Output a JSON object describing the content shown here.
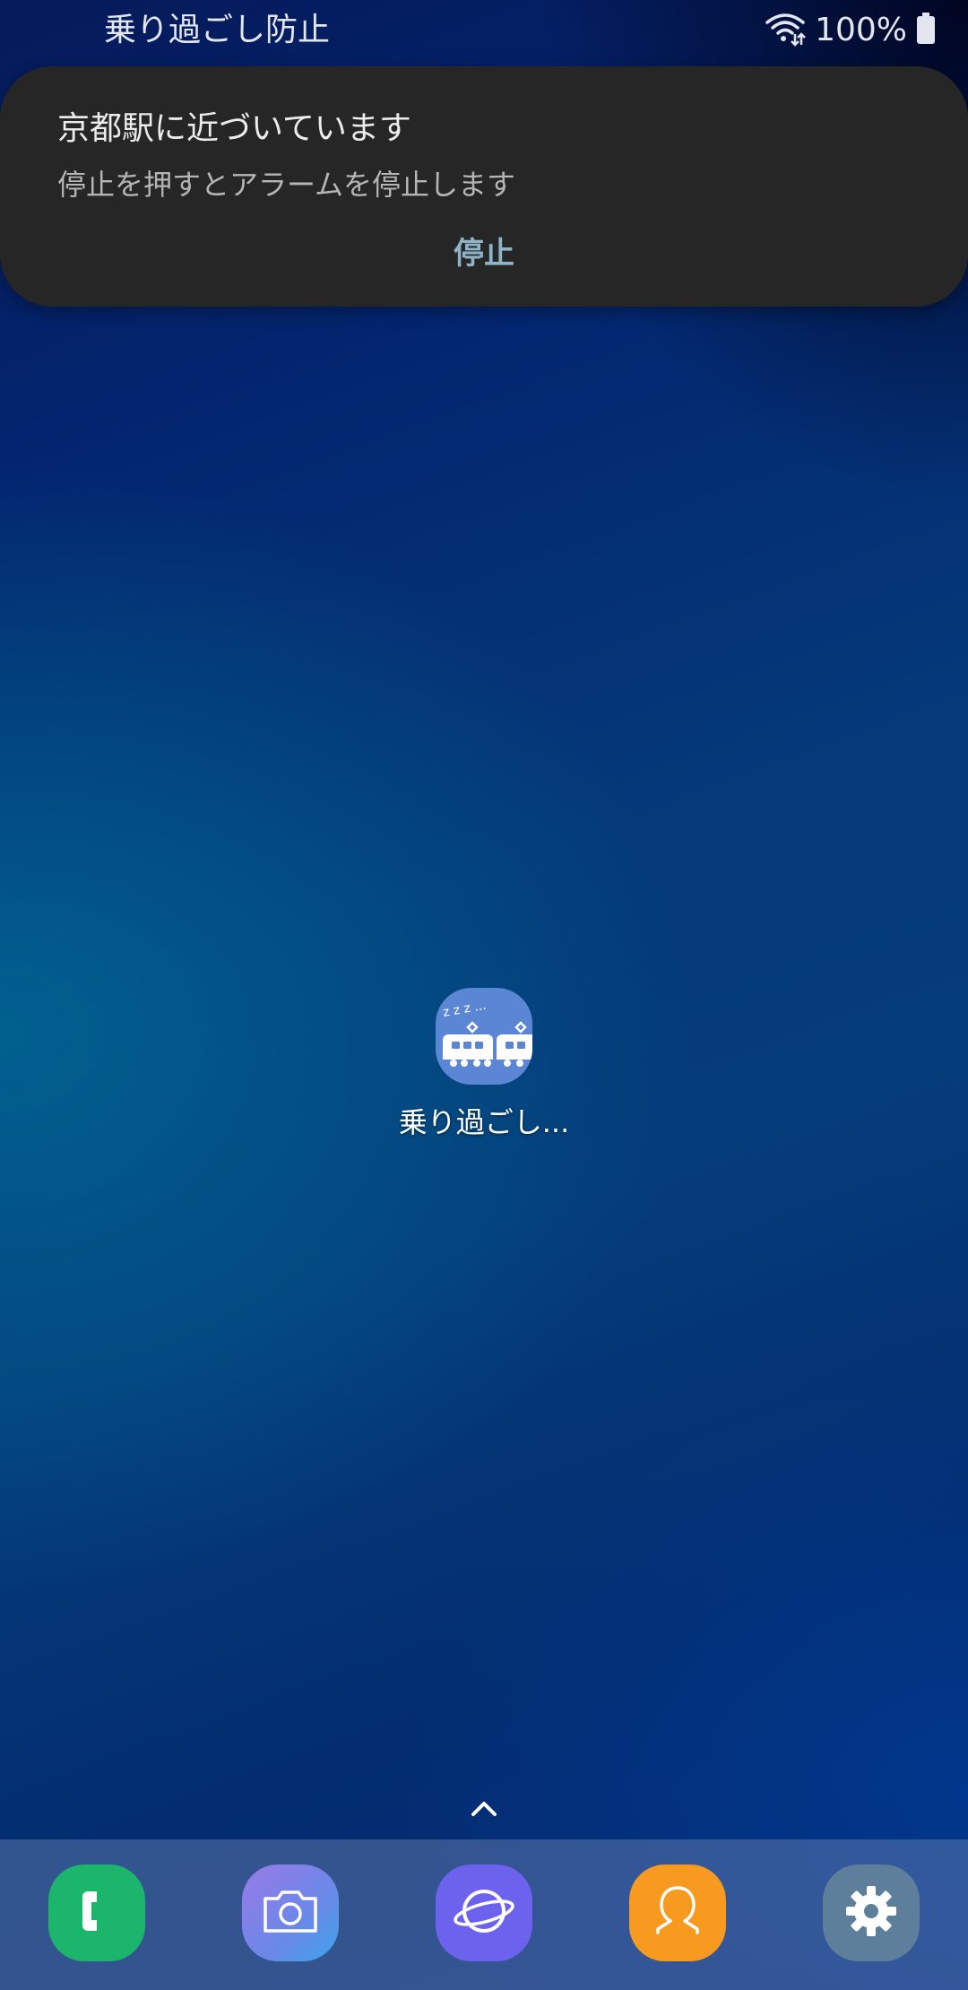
{
  "status_bar": {
    "notification_app_title": "乗り過ごし防止",
    "battery_percent": "100%",
    "icons": [
      "wifi-icon",
      "battery-icon"
    ]
  },
  "notification": {
    "title": "京都駅に近づいています",
    "body": "停止を押すとアラームを停止します",
    "action_label": "停止"
  },
  "home": {
    "app_label": "乗り過ごし...",
    "app_icon": "sleeping-train-icon"
  },
  "dock": {
    "apps": [
      {
        "icon": "phone-icon"
      },
      {
        "icon": "camera-icon"
      },
      {
        "icon": "browser-icon"
      },
      {
        "icon": "contacts-icon"
      },
      {
        "icon": "settings-icon"
      }
    ]
  },
  "colors": {
    "notification_bg": "#262626",
    "action_text": "#8fb4c8",
    "app_icon_bg": "#5b86d3",
    "phone": "#1bb56b",
    "browser": "#6c62ee",
    "contacts": "#f79a1f",
    "settings": "#5d7f9c"
  }
}
